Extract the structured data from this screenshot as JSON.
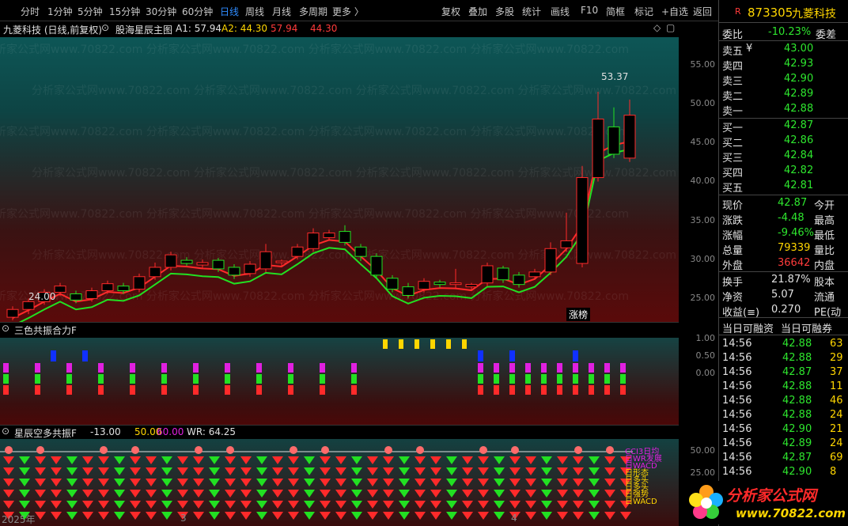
{
  "toolbar": {
    "items": [
      "分时",
      "1分钟",
      "5分钟",
      "15分钟",
      "30分钟",
      "60分钟",
      "日线",
      "周线",
      "月线",
      "多周期",
      "更多 〉"
    ],
    "right": [
      "复权",
      "叠加",
      "多股",
      "统计",
      "画线",
      "F10",
      "简框",
      "标记",
      "+自选",
      "返回"
    ]
  },
  "stock": {
    "flag": "R",
    "code": "873305",
    "name": "九菱科技"
  },
  "main_chart": {
    "title": "九菱科技 (日线,前复权)",
    "indicator": "股海星辰主图",
    "a1": "A1: 57.94",
    "a2": "A2: 44.30",
    "v1": "57.94",
    "v2": "44.30",
    "high_label": "53.37",
    "low_label": "24.00",
    "badge": "涨榜",
    "y_ticks": [
      "55.00",
      "50.00",
      "45.00",
      "40.00",
      "35.00",
      "30.00",
      "25.00"
    ],
    "candles": [
      [
        22.6,
        23.6,
        22.2,
        24.0
      ],
      [
        23.6,
        24.6,
        23.0,
        25.0
      ],
      [
        24.6,
        25.8,
        24.2,
        26.2
      ],
      [
        25.8,
        26.6,
        25.3,
        27.0
      ],
      [
        25.6,
        24.8,
        24.4,
        26.0
      ],
      [
        25.0,
        26.0,
        24.6,
        26.4
      ],
      [
        26.0,
        26.9,
        25.6,
        27.3
      ],
      [
        26.6,
        26.0,
        25.6,
        27.0
      ],
      [
        26.2,
        27.8,
        25.8,
        28.2
      ],
      [
        27.8,
        29.0,
        27.4,
        29.6
      ],
      [
        29.0,
        30.6,
        28.6,
        31.0
      ],
      [
        29.9,
        29.5,
        29.2,
        30.3
      ],
      [
        29.3,
        29.6,
        28.9,
        30.0
      ],
      [
        29.9,
        28.8,
        28.4,
        30.2
      ],
      [
        29.0,
        28.0,
        27.5,
        29.4
      ],
      [
        28.2,
        29.4,
        27.8,
        29.8
      ],
      [
        28.8,
        31.0,
        28.4,
        32.0
      ],
      [
        29.6,
        29.8,
        29.0,
        30.0
      ],
      [
        30.4,
        31.6,
        30.0,
        32.0
      ],
      [
        31.4,
        33.4,
        31.0,
        34.0
      ],
      [
        32.8,
        33.4,
        32.4,
        33.8
      ],
      [
        33.6,
        32.2,
        31.8,
        34.4
      ],
      [
        31.6,
        30.4,
        29.8,
        32.0
      ],
      [
        30.4,
        28.0,
        27.6,
        30.8
      ],
      [
        27.6,
        26.2,
        25.8,
        28.0
      ],
      [
        26.5,
        25.4,
        25.0,
        27.0
      ],
      [
        26.2,
        27.2,
        25.8,
        27.6
      ],
      [
        27.1,
        26.8,
        26.4,
        27.4
      ],
      [
        26.8,
        27.0,
        26.2,
        28.8
      ],
      [
        26.5,
        26.8,
        26.0,
        27.0
      ],
      [
        27.0,
        29.2,
        26.6,
        29.6
      ],
      [
        28.9,
        27.4,
        27.0,
        29.2
      ],
      [
        28.0,
        26.8,
        26.4,
        28.4
      ],
      [
        27.8,
        28.4,
        27.4,
        28.8
      ],
      [
        28.4,
        31.4,
        28.0,
        32.2
      ],
      [
        31.5,
        32.4,
        31.0,
        36.0
      ],
      [
        29.5,
        40.5,
        29.0,
        42.0
      ],
      [
        40.5,
        48.0,
        40.0,
        51.5
      ],
      [
        47.0,
        43.5,
        43.0,
        49.5
      ],
      [
        43.0,
        48.5,
        42.5,
        50.5
      ]
    ]
  },
  "sub1": {
    "title": "三色共振合力F",
    "y_ticks": [
      "1.00",
      "0.50",
      "0.00"
    ]
  },
  "sub2": {
    "title": "星辰空多共振F",
    "vals": "-13.00",
    "v50": "50.00",
    "v60": "60.00",
    "wr": "WR: 64.25",
    "y_ticks": [
      "50.00",
      "25.00"
    ],
    "labels": [
      "CCI3日均",
      "日WR发展",
      "日WACD",
      "日形态",
      "日多头",
      "日多头",
      "日强势",
      "日WACD"
    ]
  },
  "x_axis": {
    "year": "2025年",
    "m3": "3",
    "m4": "4"
  },
  "quote": {
    "weibi": "委比",
    "weibi_val": "-10.23%",
    "weicha": "委差",
    "asks": [
      [
        "卖五",
        "¥",
        "43.00"
      ],
      [
        "卖四",
        "",
        "42.93"
      ],
      [
        "卖三",
        "",
        "42.90"
      ],
      [
        "卖二",
        "",
        "42.89"
      ],
      [
        "卖一",
        "",
        "42.88"
      ]
    ],
    "bids": [
      [
        "买一",
        "42.87"
      ],
      [
        "买二",
        "42.86"
      ],
      [
        "买三",
        "42.84"
      ],
      [
        "买四",
        "42.82"
      ],
      [
        "买五",
        "42.81"
      ]
    ],
    "stats": [
      [
        "现价",
        "42.87",
        "今开"
      ],
      [
        "涨跌",
        "-4.48",
        "最高"
      ],
      [
        "涨幅",
        "-9.46%",
        "最低"
      ],
      [
        "总量",
        "79339",
        "量比"
      ],
      [
        "外盘",
        "36642",
        "内盘"
      ]
    ],
    "stats2": [
      [
        "换手",
        "21.87%",
        "股本"
      ],
      [
        "净资",
        "5.07",
        "流通"
      ],
      [
        "收益(≡)",
        "0.270",
        "PE(动"
      ]
    ],
    "margin": [
      "当日可融资",
      "当日可融券"
    ],
    "ticks": [
      [
        "14:56",
        "42.88",
        "63"
      ],
      [
        "14:56",
        "42.88",
        "29"
      ],
      [
        "14:56",
        "42.87",
        "37"
      ],
      [
        "14:56",
        "42.88",
        "11"
      ],
      [
        "14:56",
        "42.88",
        "46"
      ],
      [
        "14:56",
        "42.88",
        "24"
      ],
      [
        "14:56",
        "42.90",
        "21"
      ],
      [
        "14:56",
        "42.89",
        "24"
      ],
      [
        "14:56",
        "42.87",
        "69"
      ],
      [
        "14:56",
        "42.90",
        "8"
      ]
    ]
  },
  "watermark": {
    "brand": "分析家公式网",
    "url": "www.70822.com",
    "bg": "分析家公式网www.70822.com"
  },
  "colors": {
    "up": "#ff2a2a",
    "down": "#22e022",
    "accent": "#2f8cff",
    "yellow": "#ffd600",
    "magenta": "#e020e0",
    "blue": "#1030ff"
  }
}
